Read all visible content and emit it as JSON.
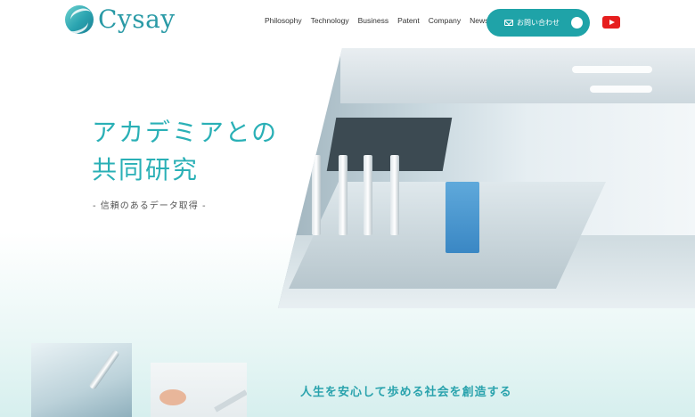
{
  "header": {
    "logo_text": "Cysay",
    "nav": [
      "Philosophy",
      "Technology",
      "Business",
      "Patent",
      "Company",
      "News"
    ],
    "contact_label": "お問い合わせ",
    "brand_color": "#1fa3a8",
    "youtube_icon": "youtube-icon"
  },
  "hero": {
    "title_line1": "アカデミアとの",
    "title_line2": "共同研究",
    "subtitle": "- 信頼のあるデータ取得 -"
  },
  "section": {
    "title": "人生を安心して歩める社会を創造する"
  }
}
